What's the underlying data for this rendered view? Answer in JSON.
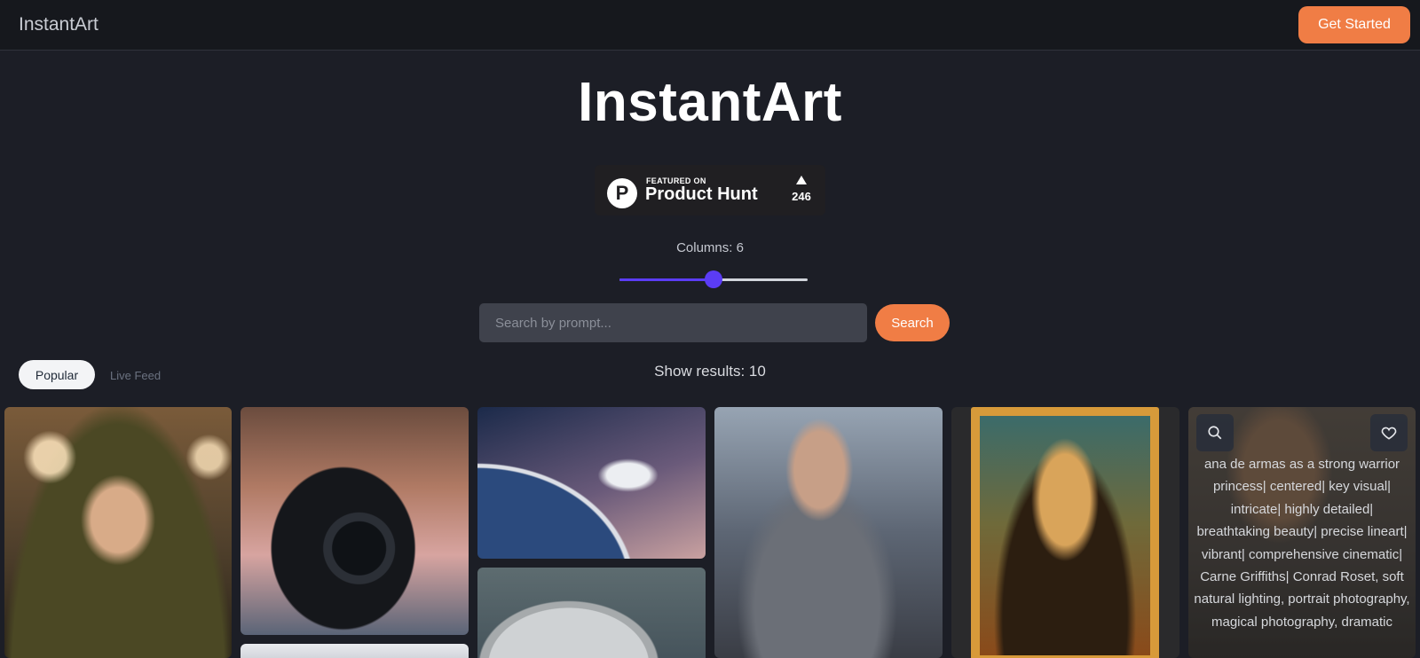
{
  "nav": {
    "brand": "InstantArt",
    "cta_label": "Get Started"
  },
  "hero": {
    "title": "InstantArt"
  },
  "product_hunt": {
    "featured": "FEATURED ON",
    "name": "Product Hunt",
    "logo_letter": "P",
    "votes": "246"
  },
  "controls": {
    "columns_label": "Columns: 6",
    "columns_value": 6,
    "columns_fraction": 0.5,
    "search_placeholder": "Search by prompt...",
    "search_label": "Search"
  },
  "tabs": {
    "popular": "Popular",
    "live": "Live Feed"
  },
  "results": {
    "text": "Show results: 10"
  },
  "gallery": {
    "hover_prompt": "ana de armas as a strong warrior princess| centered| key visual| intricate| highly detailed| breathtaking beauty| precise lineart| vibrant| comprehensive cinematic| Carne Griffiths| Conrad Roset, soft natural lighting, portrait photography, magical photography, dramatic"
  },
  "colors": {
    "accent": "#f07d45",
    "slider": "#5b3cf5",
    "background": "#1c1e26"
  }
}
